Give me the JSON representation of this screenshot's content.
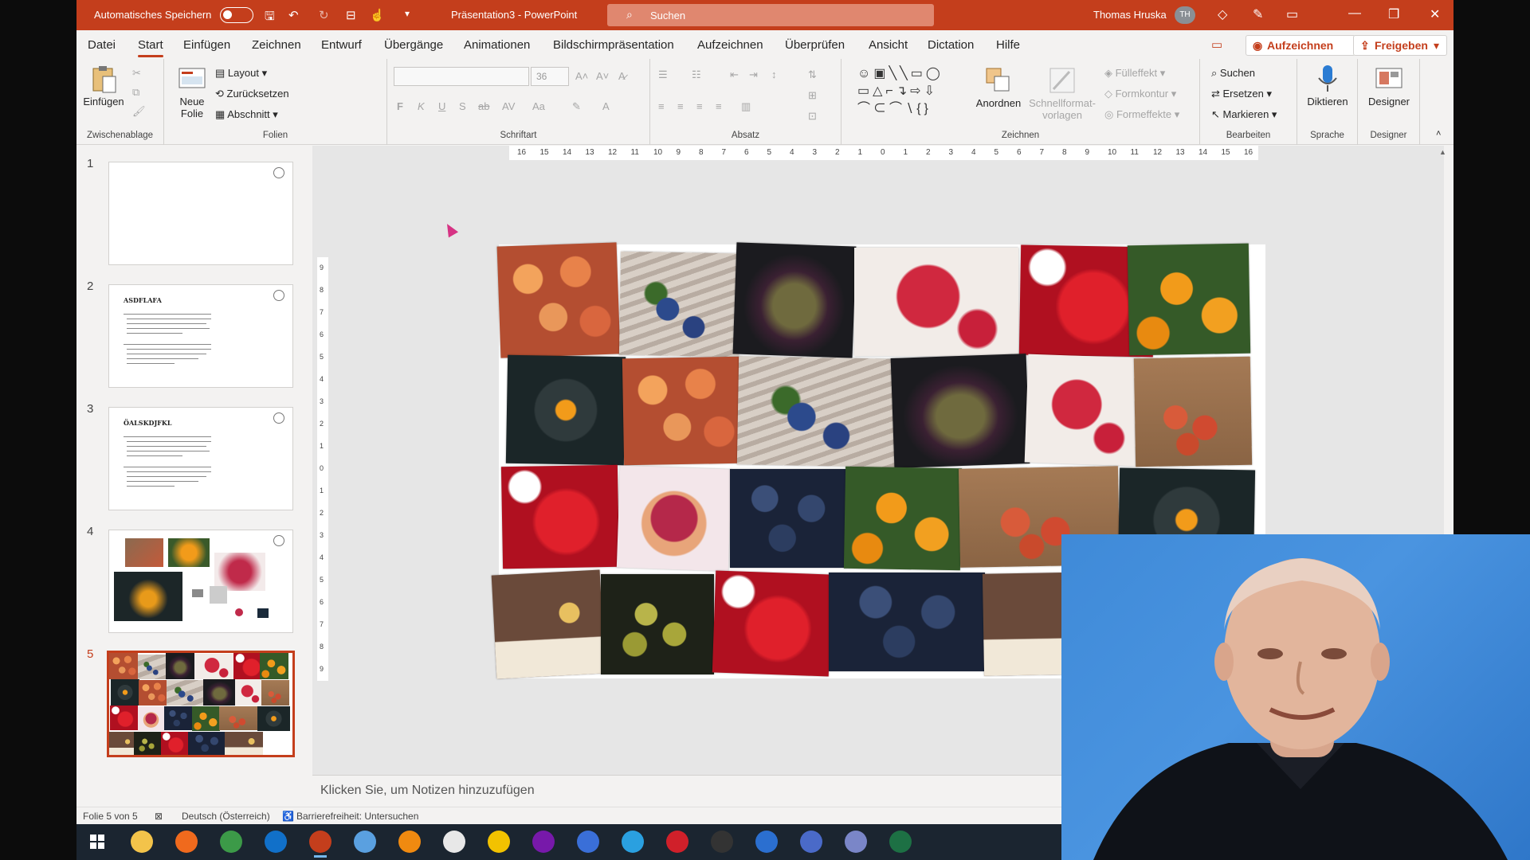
{
  "titlebar": {
    "autosave_label": "Automatisches Speichern",
    "doc_title": "Präsentation3  -  PowerPoint",
    "search_placeholder": "Suchen",
    "user_name": "Thomas Hruska",
    "user_initials": "TH"
  },
  "menu": {
    "tabs": [
      "Datei",
      "Start",
      "Einfügen",
      "Zeichnen",
      "Entwurf",
      "Übergänge",
      "Animationen",
      "Bildschirmpräsentation",
      "Aufzeichnen",
      "Überprüfen",
      "Ansicht",
      "Dictation",
      "Hilfe"
    ],
    "active_tab": "Start",
    "record_button": "Aufzeichnen",
    "share_button": "Freigeben"
  },
  "ribbon": {
    "clipboard": {
      "paste": "Einfügen",
      "group": "Zwischenablage"
    },
    "slides": {
      "new_slide": "Neue Folie",
      "layout": "Layout",
      "reset": "Zurücksetzen",
      "section": "Abschnitt",
      "group": "Folien"
    },
    "font": {
      "group": "Schriftart",
      "size": "36"
    },
    "paragraph": {
      "group": "Absatz"
    },
    "drawing": {
      "arrange": "Anordnen",
      "quick_styles": "Schnellformat-vorlagen",
      "fill": "Fülleffekt",
      "outline": "Formkontur",
      "effects": "Formeffekte",
      "group": "Zeichnen"
    },
    "editing": {
      "find": "Suchen",
      "replace": "Ersetzen",
      "select": "Markieren",
      "group": "Bearbeiten"
    },
    "voice": {
      "dictate": "Diktieren",
      "group": "Sprache"
    },
    "designer": {
      "label": "Designer",
      "group": "Designer"
    }
  },
  "ruler": {
    "h_ticks": [
      "16",
      "15",
      "14",
      "13",
      "12",
      "11",
      "10",
      "9",
      "8",
      "7",
      "6",
      "5",
      "4",
      "3",
      "2",
      "1",
      "0",
      "1",
      "2",
      "3",
      "4",
      "5",
      "6",
      "7",
      "8",
      "9",
      "10",
      "11",
      "12",
      "13",
      "14",
      "15",
      "16"
    ],
    "v_ticks": [
      "9",
      "8",
      "7",
      "6",
      "5",
      "4",
      "3",
      "2",
      "1",
      "0",
      "1",
      "2",
      "3",
      "4",
      "5",
      "6",
      "7",
      "8",
      "9"
    ]
  },
  "thumbnails": [
    {
      "number": "1",
      "title": ""
    },
    {
      "number": "2",
      "title": "ASDFLAFA"
    },
    {
      "number": "3",
      "title": "ÖALSKDJFKL"
    },
    {
      "number": "4",
      "title": ""
    },
    {
      "number": "5",
      "title": ""
    }
  ],
  "notes_placeholder": "Klicken Sie, um Notizen hinzuzufügen",
  "status": {
    "slide_info": "Folie 5 von 5",
    "language": "Deutsch (Österreich)",
    "accessibility": "Barrierefreiheit: Untersuchen"
  },
  "colors": {
    "accent": "#c43e1c",
    "ribbon_bg": "#f3f2f1",
    "taskbar": "#1b2530",
    "webcam_bg": "#3f8ad8"
  },
  "slide_photos": [
    "apples",
    "blueberries",
    "fig",
    "raspberry",
    "strawberry",
    "oranges-tree",
    "oranges-bowl",
    "apples",
    "blueberries",
    "fig",
    "raspberry",
    "blood-orange-board",
    "strawberry",
    "raspberries-bowl",
    "blueberries-dark",
    "oranges-tree",
    "blood-orange-board",
    "oranges-bowl",
    "smoothies",
    "limes",
    "strawberry",
    "blueberries-dark",
    "smoothies"
  ],
  "taskbar_apps": [
    "windows-start",
    "file-explorer",
    "firefox",
    "chrome",
    "outlook",
    "powerpoint",
    "snip",
    "vlc",
    "paint",
    "pixel",
    "onenote",
    "visio",
    "telegram",
    "acrobat",
    "obs",
    "media",
    "camtasia",
    "teams",
    "excel"
  ]
}
